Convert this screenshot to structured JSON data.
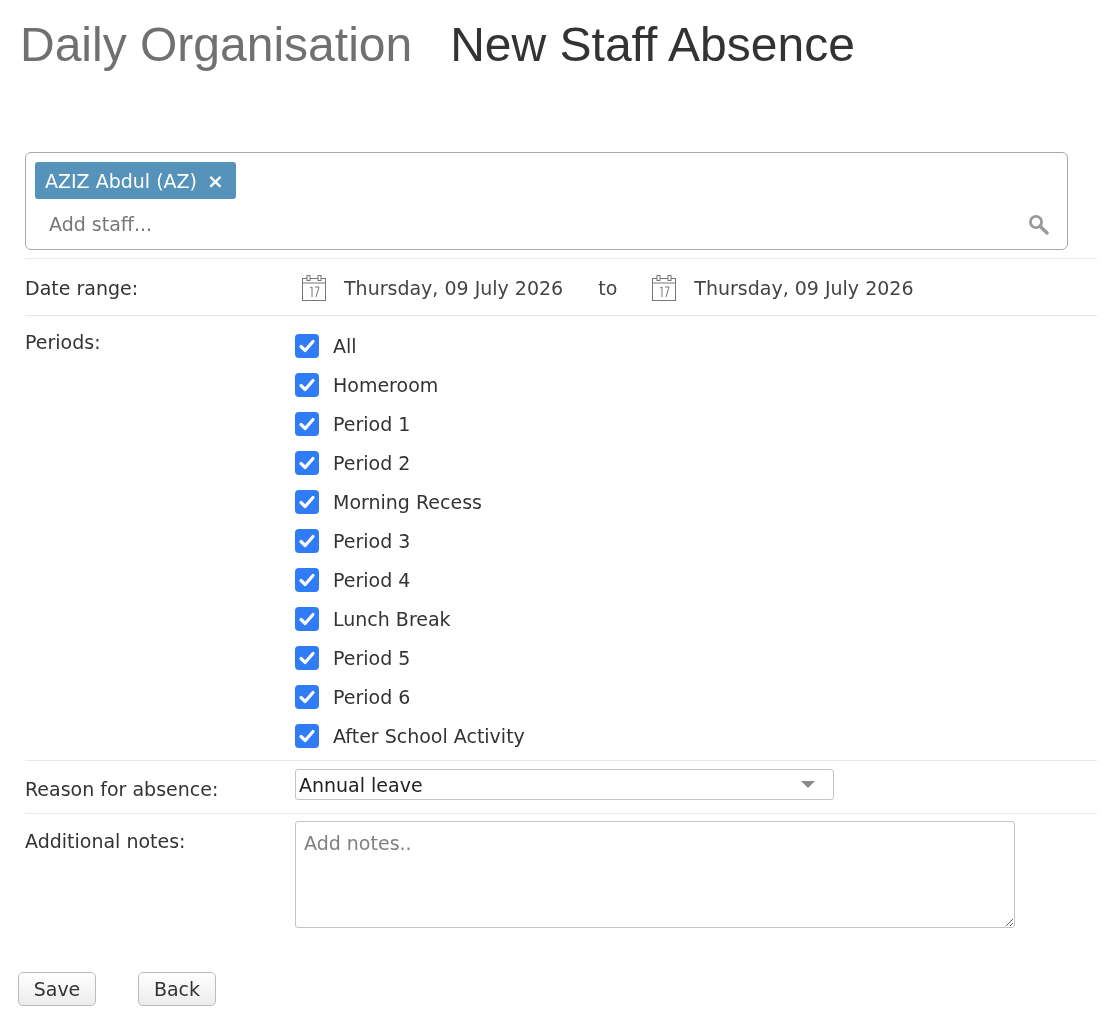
{
  "header": {
    "section": "Daily Organisation",
    "title": "New Staff Absence"
  },
  "staff_picker": {
    "tags": [
      {
        "label": "AZIZ Abdul (AZ)",
        "remove": "×"
      }
    ],
    "placeholder": "Add staff..."
  },
  "date_range": {
    "label": "Date range:",
    "from": "Thursday, 09 July 2026",
    "separator": "to",
    "to": "Thursday, 09 July 2026"
  },
  "periods": {
    "label": "Periods:",
    "items": [
      {
        "label": "All",
        "checked": true
      },
      {
        "label": "Homeroom",
        "checked": true
      },
      {
        "label": "Period 1",
        "checked": true
      },
      {
        "label": "Period 2",
        "checked": true
      },
      {
        "label": "Morning Recess",
        "checked": true
      },
      {
        "label": "Period 3",
        "checked": true
      },
      {
        "label": "Period 4",
        "checked": true
      },
      {
        "label": "Lunch Break",
        "checked": true
      },
      {
        "label": "Period 5",
        "checked": true
      },
      {
        "label": "Period 6",
        "checked": true
      },
      {
        "label": "After School Activity",
        "checked": true
      }
    ]
  },
  "reason": {
    "label": "Reason for absence:",
    "value": "Annual leave"
  },
  "notes": {
    "label": "Additional notes:",
    "placeholder": "Add notes.."
  },
  "buttons": [
    "Save",
    "Back"
  ]
}
